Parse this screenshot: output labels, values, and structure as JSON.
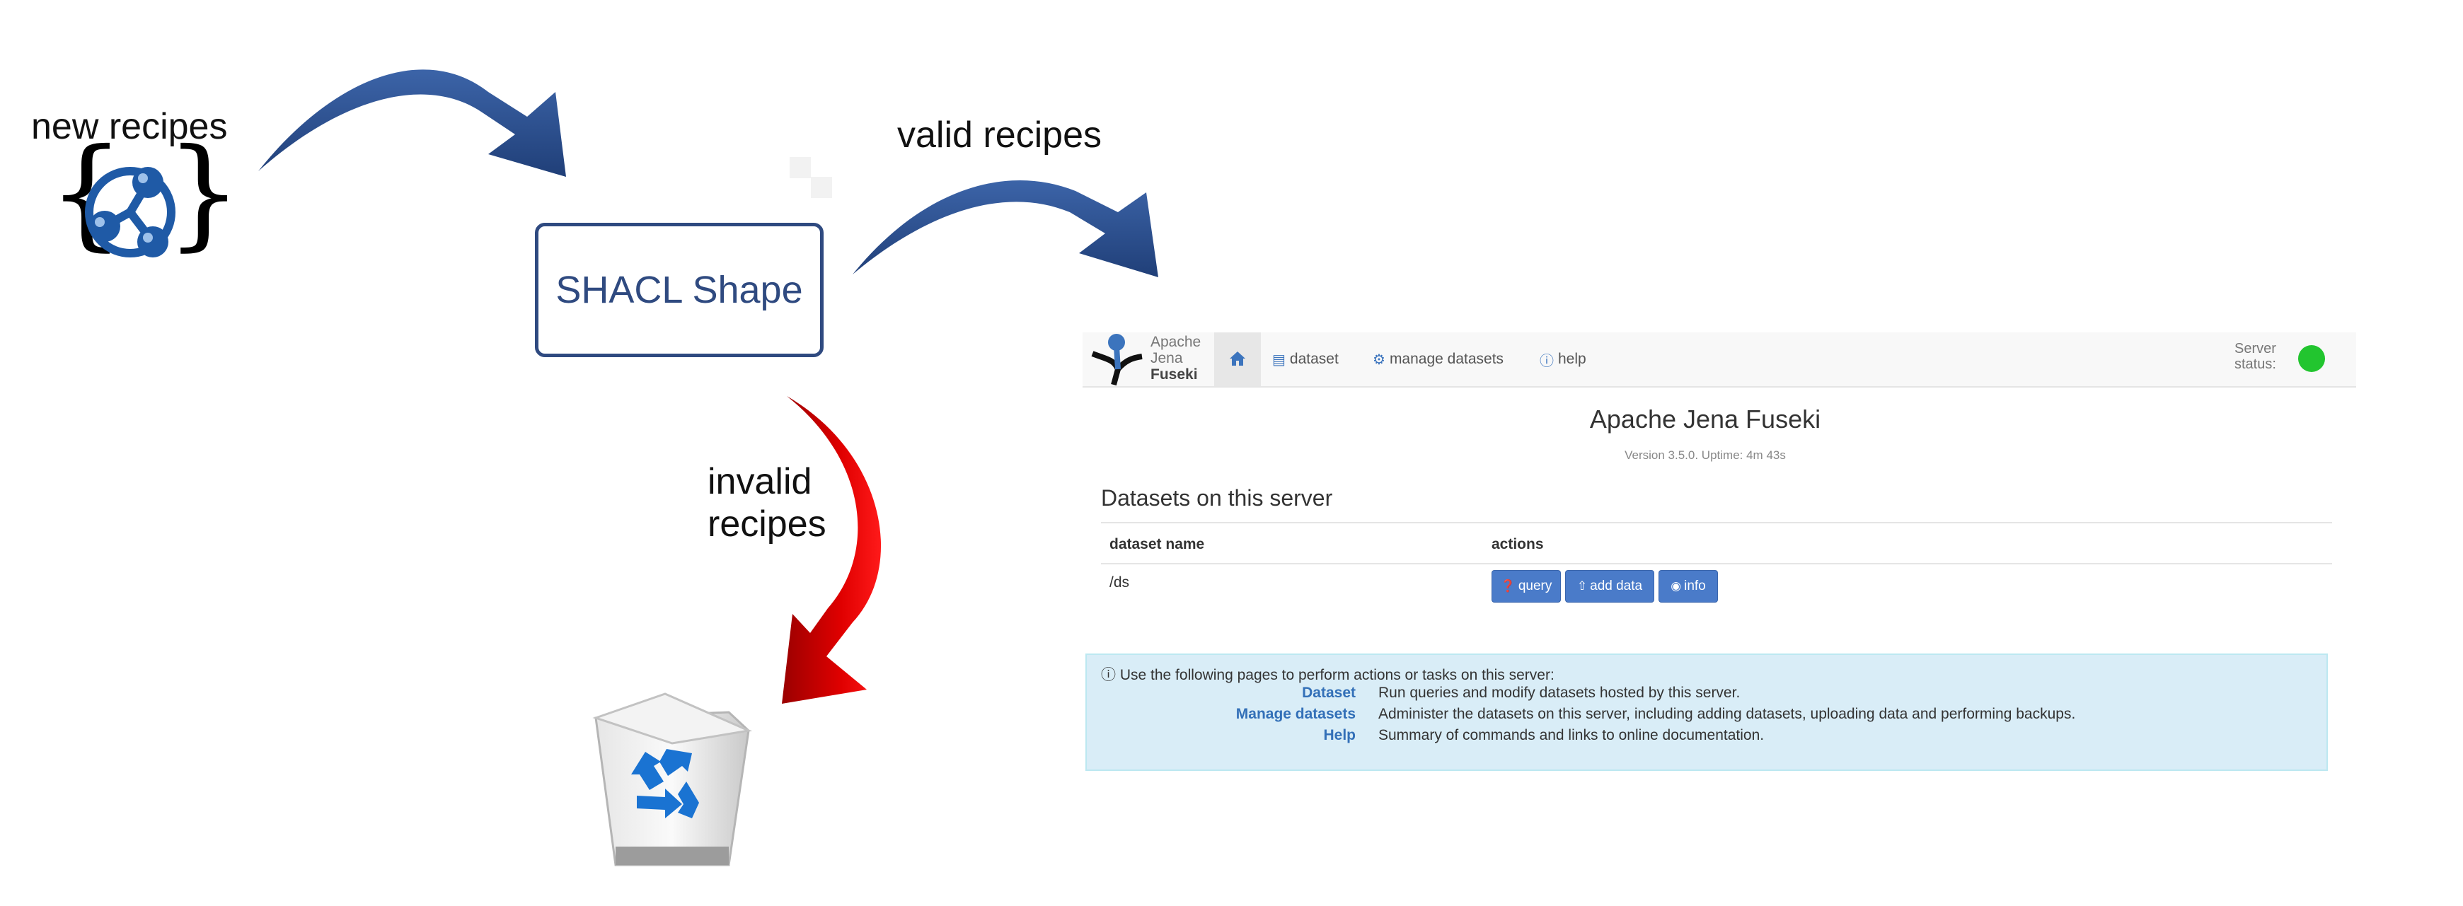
{
  "labels": {
    "new_recipes": "new recipes",
    "valid_recipes": "valid recipes",
    "invalid_recipes_line1": "invalid",
    "invalid_recipes_line2": "recipes",
    "shacl_shape": "SHACL Shape",
    "json_braces_left": "{",
    "json_braces_right": "}"
  },
  "colors": {
    "blue_arrow": "#2f5492",
    "red_arrow": "#e00000",
    "shape_border": "#2f4a80",
    "status_ok": "#22c52f"
  },
  "icons": {
    "json_ld": "json-ld-icon",
    "recycle_bin": "recycle-bin-icon",
    "fuseki_logo": "fuseki-logo-icon"
  },
  "fuseki": {
    "brand": {
      "line1": "Apache",
      "line2": "Jena",
      "line3": "Fuseki"
    },
    "nav": {
      "home_icon": "home-icon",
      "dataset": "dataset",
      "manage_datasets": "manage datasets",
      "help": "help"
    },
    "server_status": {
      "line1": "Server",
      "line2": "status:"
    },
    "title": "Apache Jena Fuseki",
    "version": "Version 3.5.0. Uptime: 4m 43s",
    "datasets_heading": "Datasets on this server",
    "table": {
      "col_name": "dataset name",
      "col_actions": "actions",
      "rows": [
        {
          "name": "/ds"
        }
      ]
    },
    "buttons": {
      "query": "query",
      "add_data": "add data",
      "info": "info"
    },
    "info_box": {
      "intro": "Use the following pages to perform actions or tasks on this server:",
      "items": [
        {
          "link": "Dataset",
          "desc": "Run queries and modify datasets hosted by this server."
        },
        {
          "link": "Manage datasets",
          "desc": "Administer the datasets on this server, including adding datasets, uploading data and performing backups."
        },
        {
          "link": "Help",
          "desc": "Summary of commands and links to online documentation."
        }
      ]
    }
  }
}
